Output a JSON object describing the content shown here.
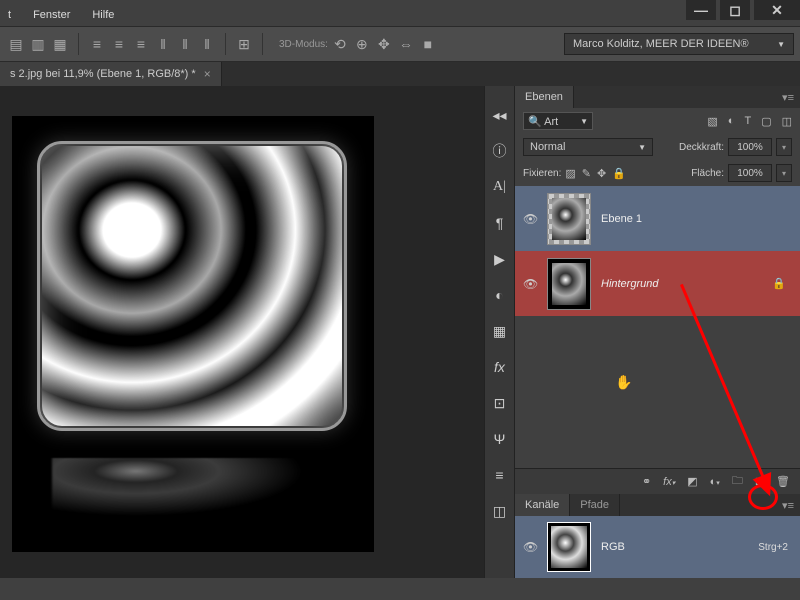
{
  "menu": {
    "items": [
      "t",
      "Fenster",
      "Hilfe"
    ]
  },
  "window_controls": {
    "min": "—",
    "max": "◻",
    "close": "✕"
  },
  "toolbar": {
    "mode_label": "3D-Modus:",
    "account": "Marco Kolditz, MEER DER IDEEN®"
  },
  "tab": {
    "title": "s 2.jpg bei 11,9% (Ebene 1, RGB/8*) *"
  },
  "panels": {
    "layers": {
      "tab": "Ebenen",
      "search_label": "Art",
      "blend_mode": "Normal",
      "opacity_label": "Deckkraft:",
      "opacity_value": "100%",
      "fix_label": "Fixieren:",
      "fill_label": "Fläche:",
      "fill_value": "100%",
      "layers": [
        {
          "name": "Ebene 1"
        },
        {
          "name": "Hintergrund"
        }
      ]
    },
    "channels": {
      "tab": "Kanäle",
      "paths_tab": "Pfade",
      "channel_name": "RGB",
      "shortcut": "Strg+2"
    }
  }
}
